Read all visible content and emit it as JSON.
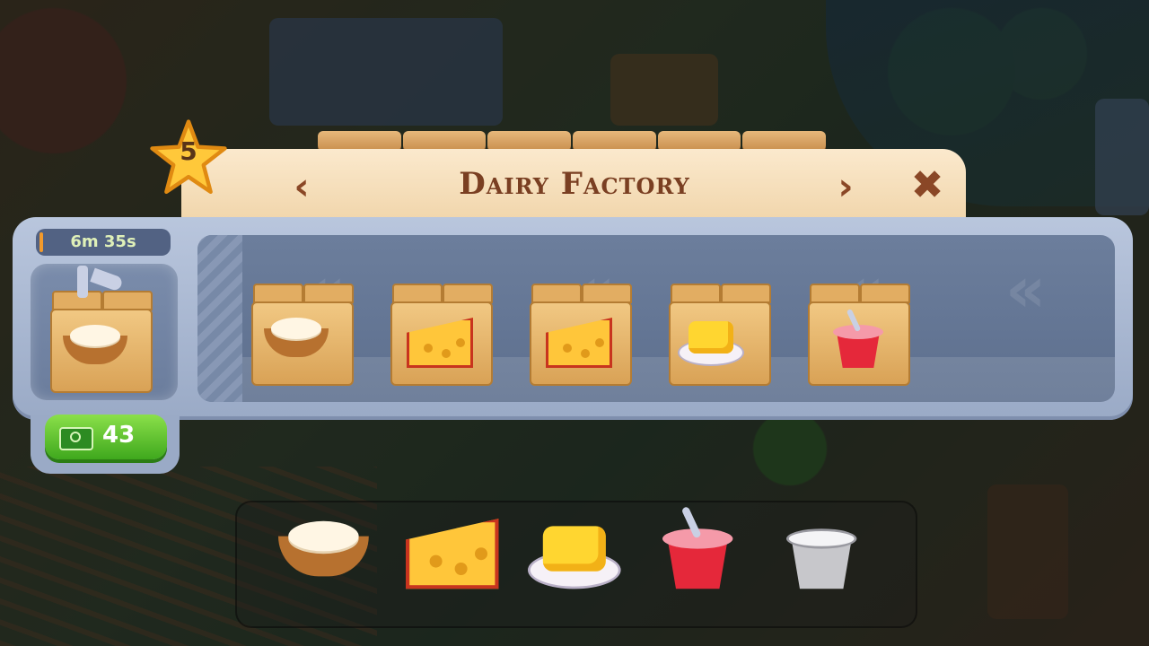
{
  "window": {
    "title": "Dairy Factory",
    "level": "5"
  },
  "nav": {
    "prev_glyph": "‹",
    "next_glyph": "›",
    "close_glyph": "✖"
  },
  "production": {
    "timer": "6m 35s",
    "current_item": "cream",
    "speed_up_cost": "43",
    "queue": [
      "cream",
      "cheese",
      "cheese",
      "butter",
      "yogurt"
    ]
  },
  "products": [
    "cream",
    "cheese",
    "butter",
    "yogurt",
    "yogurt-locked"
  ],
  "colors": {
    "title": "#7a3f22",
    "panel": "#9aaac6",
    "speed_button": "#3fa81d",
    "timer_text": "#dff0b8"
  }
}
